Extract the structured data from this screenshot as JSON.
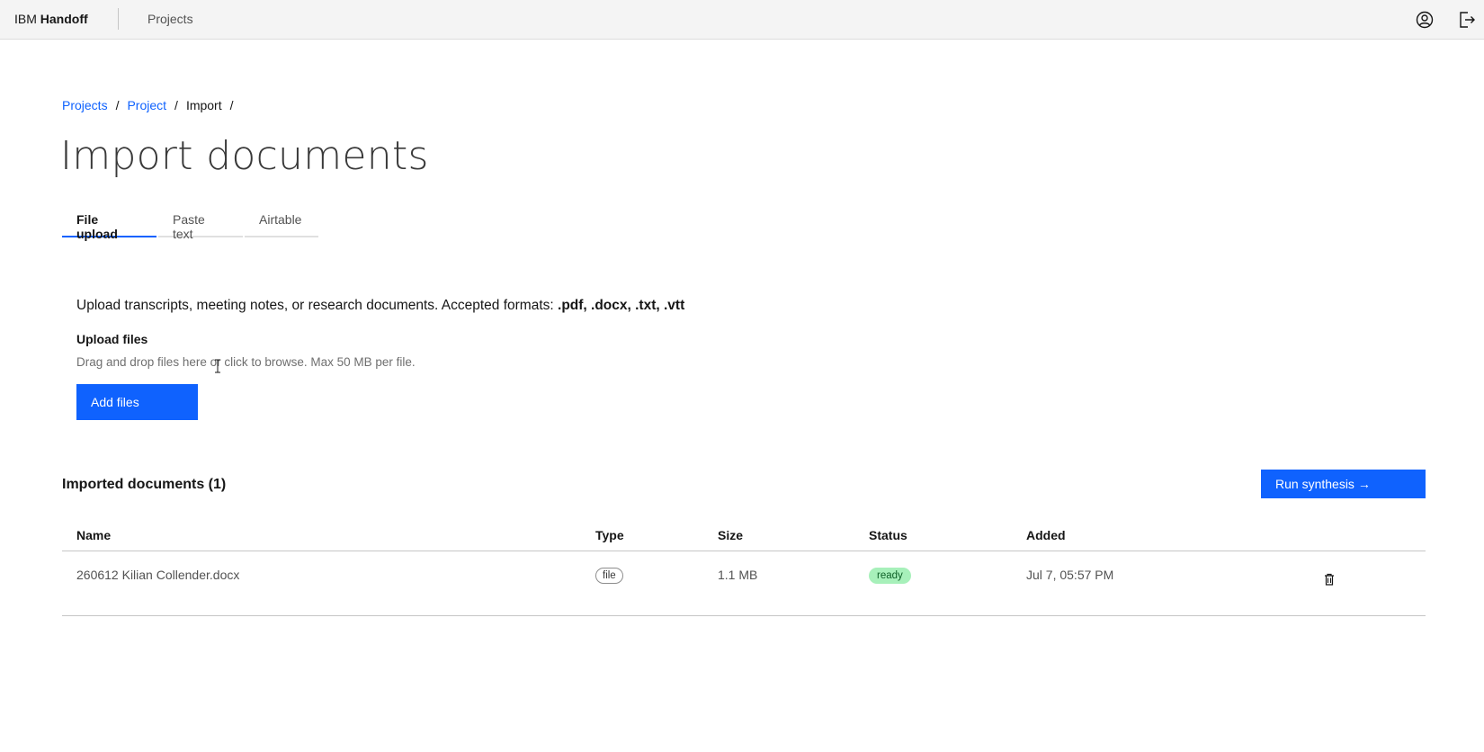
{
  "header": {
    "brand_prefix": "IBM",
    "brand_name": "Handoff",
    "nav_projects": "Projects"
  },
  "breadcrumb": {
    "items": [
      "Projects",
      "Project",
      "Import"
    ],
    "separator": "/"
  },
  "page": {
    "title": "Import documents"
  },
  "tabs": [
    {
      "label": "File upload",
      "active": true
    },
    {
      "label": "Paste text",
      "active": false
    },
    {
      "label": "Airtable",
      "active": false
    }
  ],
  "upload": {
    "description_prefix": "Upload transcripts, meeting notes, or research documents. Accepted formats: ",
    "accepted_formats": ".pdf, .docx, .txt, .vtt",
    "label": "Upload files",
    "helper": "Drag and drop files here or click to browse. Max 50 MB per file.",
    "add_button": "Add files"
  },
  "imported": {
    "title": "Imported documents (1)",
    "run_button": "Run synthesis →",
    "columns": [
      "Name",
      "Type",
      "Size",
      "Status",
      "Added"
    ],
    "rows": [
      {
        "name": "260612 Kilian Collender.docx",
        "type": "file",
        "size": "1.1 MB",
        "status": "ready",
        "added": "Jul 7, 05:57 PM"
      }
    ]
  },
  "colors": {
    "primary": "#0f62fe",
    "ready_bg": "#a7f0ba",
    "ready_text": "#0e6027",
    "header_bg": "#f4f4f4"
  },
  "icons": {
    "user": "user-avatar-icon",
    "logout": "logout-icon",
    "delete": "trash-icon"
  }
}
